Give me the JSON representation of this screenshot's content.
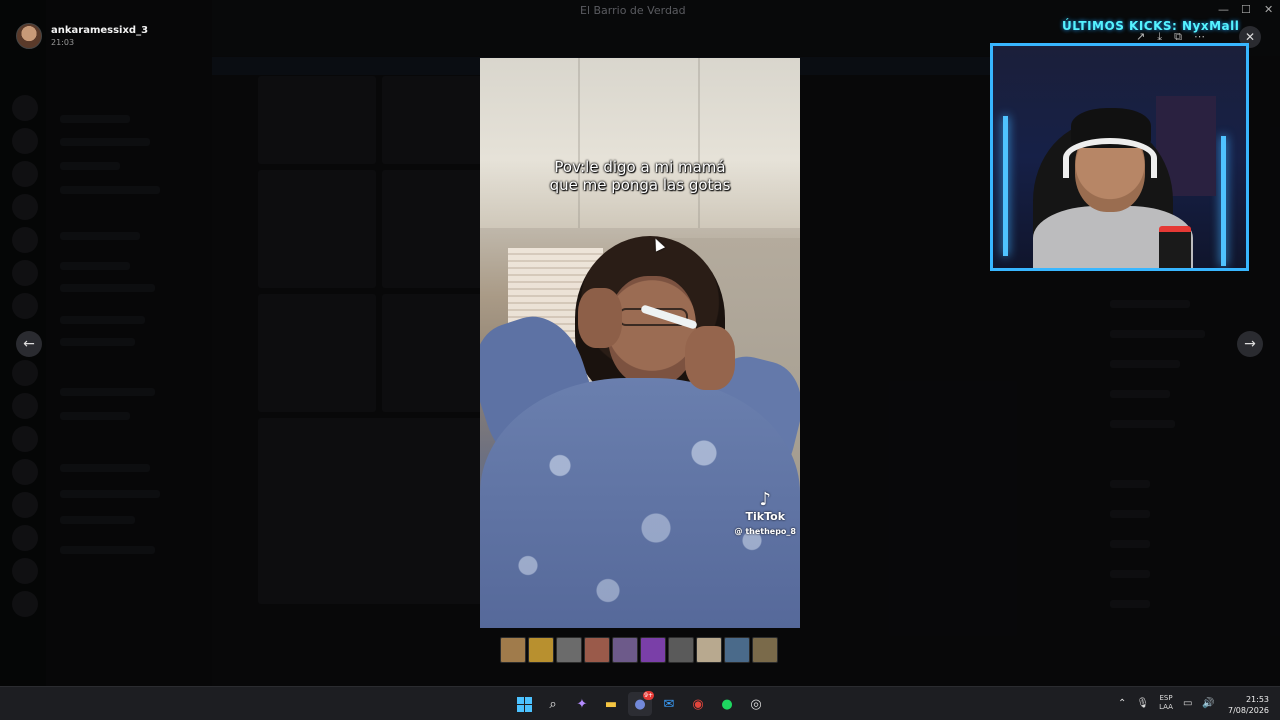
{
  "window": {
    "title": "El Barrio de Verdad"
  },
  "user": {
    "name": "ankaramessixd_3",
    "time": "21:03"
  },
  "viewer": {
    "caption_line1": "Pov:le digo a mi mamá",
    "caption_line2": "que me ponga las gotas",
    "watermark_brand": "TikTok",
    "watermark_handle": "@ thethepo_8",
    "prev_icon": "arrow-left-icon",
    "next_icon": "arrow-right-icon",
    "close_icon": "close-icon",
    "tools": [
      "share-icon",
      "download-icon",
      "open-external-icon",
      "more-icon"
    ]
  },
  "thumbnails": [
    {
      "color": "#a07b4b"
    },
    {
      "color": "#b8902f"
    },
    {
      "color": "#6b6b6b"
    },
    {
      "color": "#9a5a4a"
    },
    {
      "color": "#6d5a8a"
    },
    {
      "color": "#7a3fa8"
    },
    {
      "color": "#5a5a5a"
    },
    {
      "color": "#b8a98f"
    },
    {
      "color": "#4a6a8a"
    },
    {
      "color": "#7a6a4a"
    }
  ],
  "stream": {
    "overlay_text": "ÚLTIMOS KICKS: NyxMall",
    "accent": "#38b6ff"
  },
  "taskbar": {
    "apps": [
      "windows-start-icon",
      "search-icon",
      "copilot-icon",
      "file-explorer-icon",
      "discord-icon",
      "outlook-icon",
      "chrome-icon",
      "spotify-icon",
      "obs-icon"
    ],
    "discord_badge": "9+",
    "language_1": "ESP",
    "language_2": "LAA",
    "time": "21:53",
    "date": "7/08/2026"
  }
}
